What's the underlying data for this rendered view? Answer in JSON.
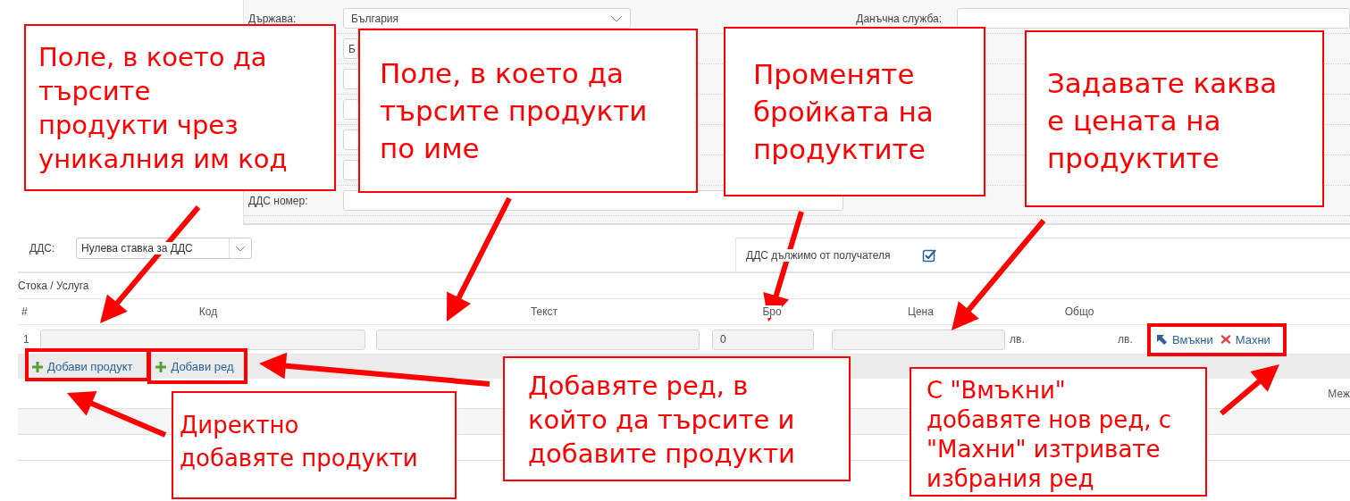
{
  "company_form": {
    "country": {
      "label": "Държава:",
      "value": "България"
    },
    "second_select": {
      "value": "Б"
    },
    "tax_office": {
      "label": "Данъчна служба:"
    },
    "vat_number": {
      "label": "ДДС номер:"
    }
  },
  "vat": {
    "label": "ДДС:",
    "value": "Нулева ставка за ДДС"
  },
  "reverse_charge": {
    "label": "ДДС дължимо от получателя",
    "checked": true
  },
  "section_title": "Стока / Услуга",
  "table": {
    "columns": [
      "#",
      "Код",
      "Текст",
      "Бро",
      "Цена",
      "Общо"
    ],
    "rows": [
      {
        "number": "1",
        "quantity": "0",
        "price_currency": "лв.",
        "total_currency": "лв."
      }
    ]
  },
  "row_actions": [
    {
      "kind": "insert",
      "label": "Вмъкни"
    },
    {
      "kind": "remove",
      "label": "Махни"
    }
  ],
  "toolbar_buttons": [
    "Добави продукт",
    "Добави ред"
  ],
  "summary_label": "Меж",
  "callouts": [
    {
      "text": "Поле, в което да\nтърсите\nпродукти чрез\nуникалния им код"
    },
    {
      "text": "Поле, в което да\nтърсите продукти\nпо име"
    },
    {
      "text": "Променяте\nбройката на\nпродуктите"
    },
    {
      "text": "Задавате каква\nе цената на\nпродуктите"
    },
    {
      "text": "Директно\nдобавяте продукти"
    },
    {
      "text": "Добавяте ред, в\nкойто да търсите и\nдобавите продукти"
    },
    {
      "text": "С \"Вмъкни\"\nдобавяте нов ред, с\n\"Махни\" изтривате\nизбрания ред"
    }
  ]
}
